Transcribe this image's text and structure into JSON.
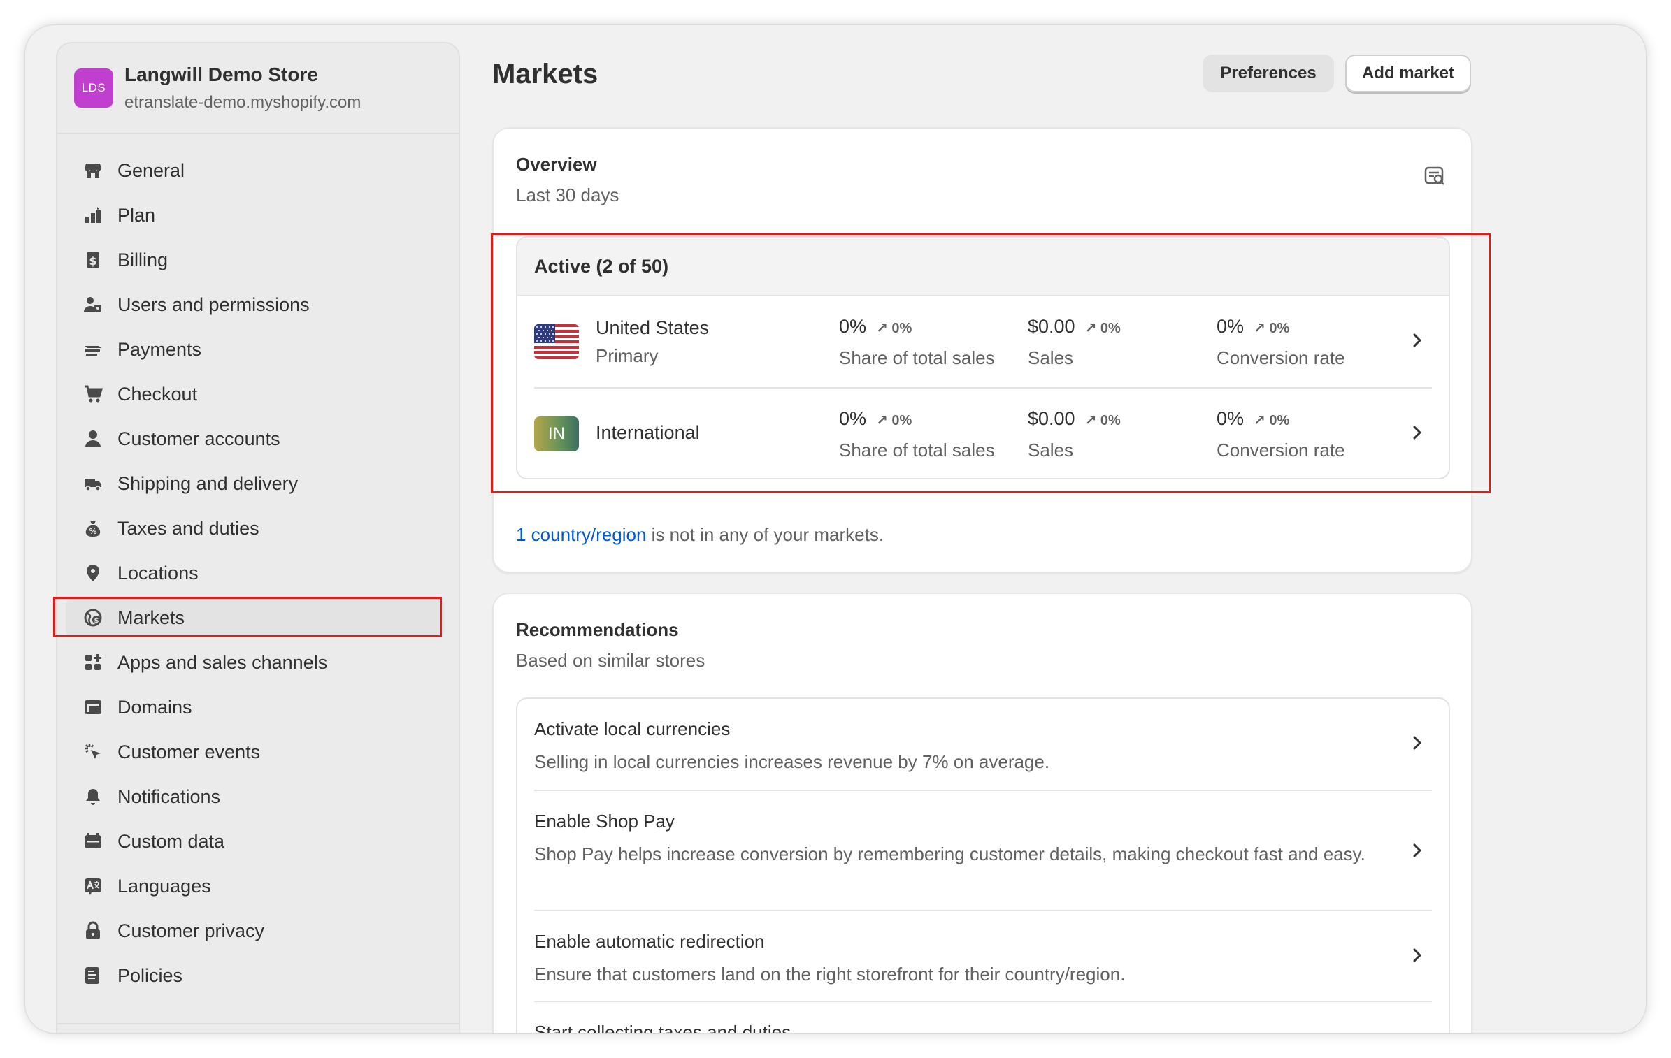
{
  "store": {
    "initials": "LDS",
    "name": "Langwill Demo Store",
    "domain": "etranslate-demo.myshopify.com"
  },
  "sidebar": {
    "items": [
      {
        "label": "General",
        "icon": "store-icon"
      },
      {
        "label": "Plan",
        "icon": "plan-icon"
      },
      {
        "label": "Billing",
        "icon": "billing-icon"
      },
      {
        "label": "Users and permissions",
        "icon": "users-icon"
      },
      {
        "label": "Payments",
        "icon": "payments-icon"
      },
      {
        "label": "Checkout",
        "icon": "cart-icon"
      },
      {
        "label": "Customer accounts",
        "icon": "person-icon"
      },
      {
        "label": "Shipping and delivery",
        "icon": "truck-icon"
      },
      {
        "label": "Taxes and duties",
        "icon": "money-bag-icon"
      },
      {
        "label": "Locations",
        "icon": "location-pin-icon"
      },
      {
        "label": "Markets",
        "icon": "globe-icon"
      },
      {
        "label": "Apps and sales channels",
        "icon": "apps-icon"
      },
      {
        "label": "Domains",
        "icon": "domains-icon"
      },
      {
        "label": "Customer events",
        "icon": "cursor-click-icon"
      },
      {
        "label": "Notifications",
        "icon": "bell-icon"
      },
      {
        "label": "Custom data",
        "icon": "database-icon"
      },
      {
        "label": "Languages",
        "icon": "translate-icon"
      },
      {
        "label": "Customer privacy",
        "icon": "lock-icon"
      },
      {
        "label": "Policies",
        "icon": "policy-icon"
      }
    ]
  },
  "header": {
    "title": "Markets",
    "preferences_label": "Preferences",
    "add_market_label": "Add market"
  },
  "overview": {
    "title": "Overview",
    "subtitle": "Last 30 days",
    "active_header": "Active (2 of 50)",
    "markets": [
      {
        "name": "United States",
        "sub": "Primary",
        "share": "0%",
        "share_delta": "0%",
        "share_label": "Share of total sales",
        "sales": "$0.00",
        "sales_delta": "0%",
        "sales_label": "Sales",
        "conv": "0%",
        "conv_delta": "0%",
        "conv_label": "Conversion rate"
      },
      {
        "name": "International",
        "badge": "IN",
        "share": "0%",
        "share_delta": "0%",
        "share_label": "Share of total sales",
        "sales": "$0.00",
        "sales_delta": "0%",
        "sales_label": "Sales",
        "conv": "0%",
        "conv_delta": "0%",
        "conv_label": "Conversion rate"
      }
    ],
    "footer_link": "1 country/region",
    "footer_text": " is not in any of your markets."
  },
  "recommendations": {
    "title": "Recommendations",
    "subtitle": "Based on similar stores",
    "items": [
      {
        "title": "Activate local currencies",
        "desc": "Selling in local currencies increases revenue by 7% on average."
      },
      {
        "title": "Enable Shop Pay",
        "desc": "Shop Pay helps increase conversion by remembering customer details, making checkout fast and easy."
      },
      {
        "title": "Enable automatic redirection",
        "desc": "Ensure that customers land on the right storefront for their country/region."
      },
      {
        "title": "Start collecting taxes and duties",
        "desc": ""
      }
    ]
  },
  "colors": {
    "highlight": "#e01b1b",
    "link": "#005bd3",
    "avatar": "#c03fcf"
  }
}
